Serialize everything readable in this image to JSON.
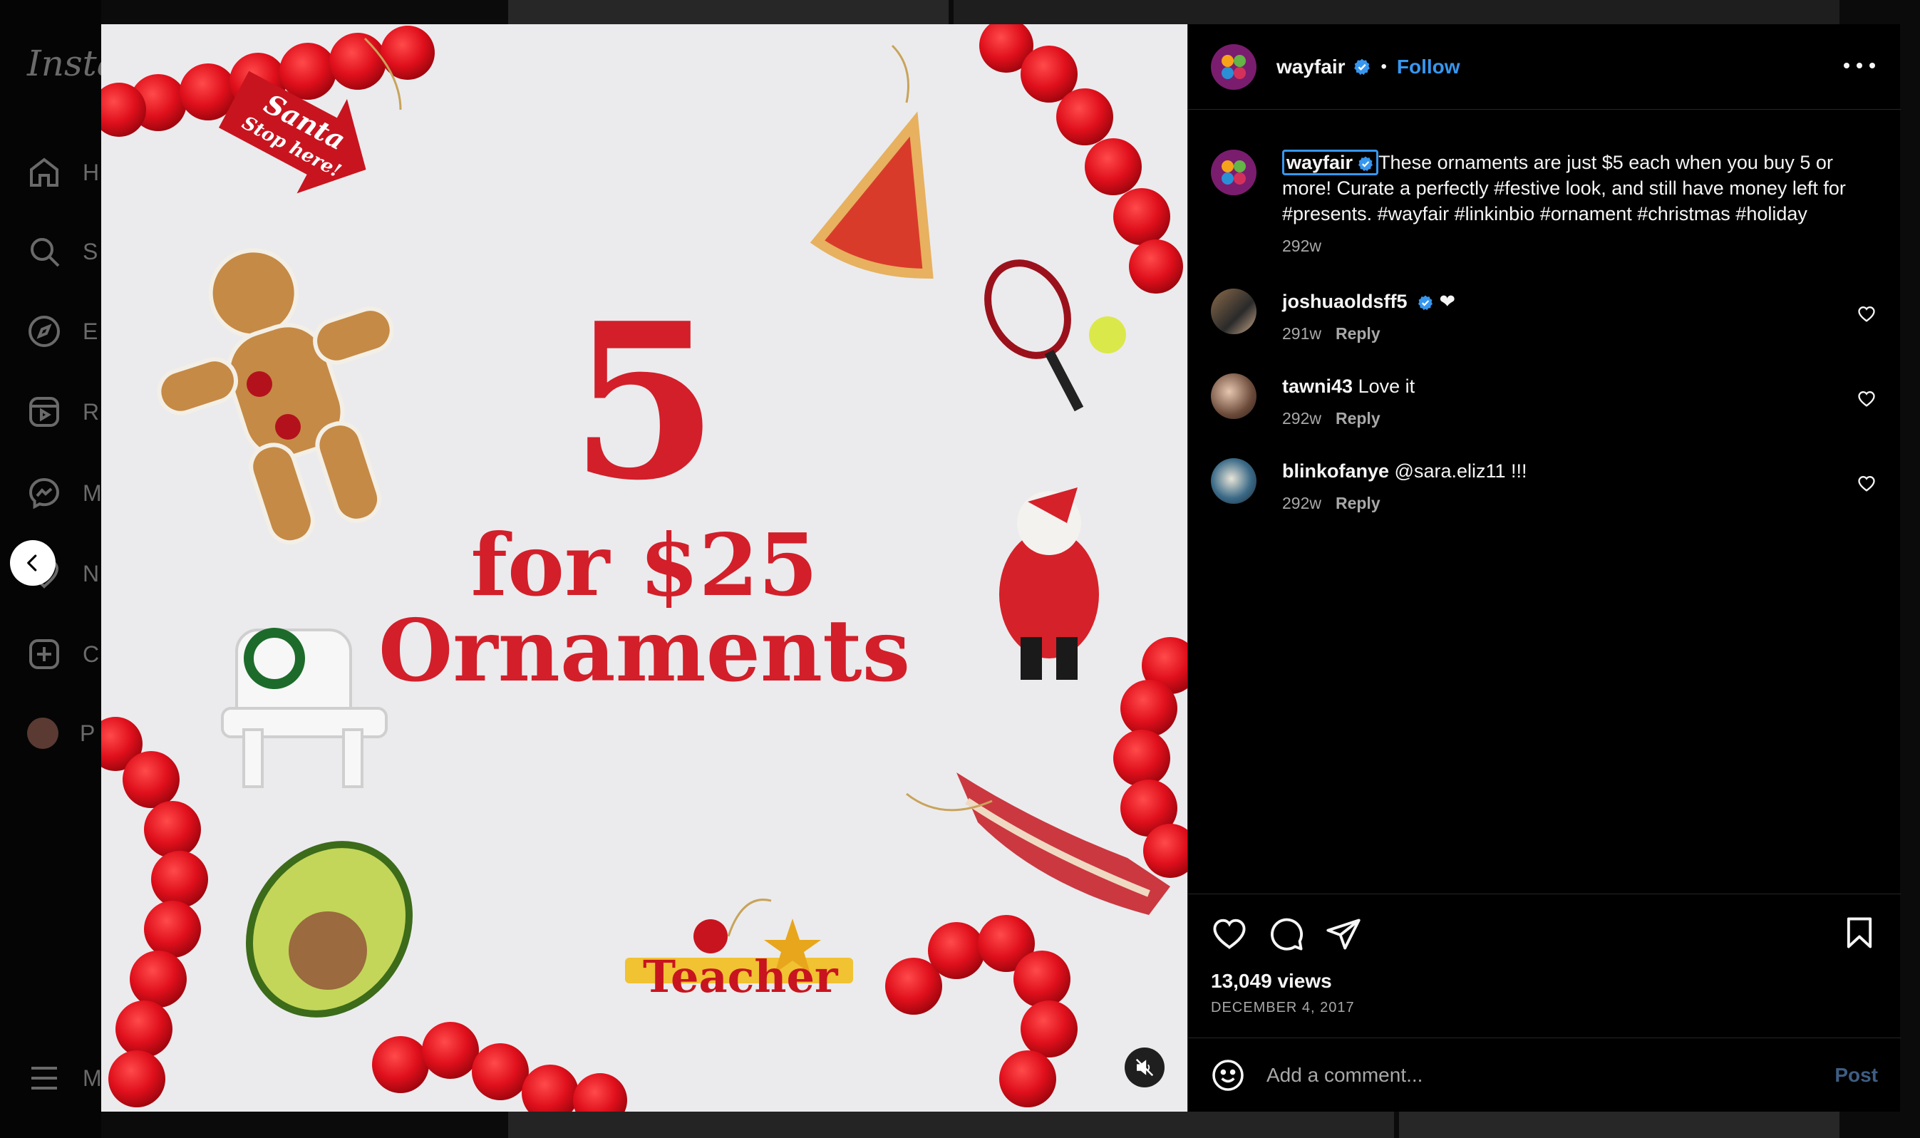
{
  "sidebar": {
    "logo": "Insta",
    "items": [
      {
        "label": "H",
        "icon": "home-icon"
      },
      {
        "label": "S",
        "icon": "search-icon"
      },
      {
        "label": "E",
        "icon": "explore-icon"
      },
      {
        "label": "R",
        "icon": "reels-icon"
      },
      {
        "label": "M",
        "icon": "messenger-icon"
      },
      {
        "label": "N",
        "icon": "notifications-icon"
      },
      {
        "label": "C",
        "icon": "create-icon"
      },
      {
        "label": "P",
        "icon": "profile-avatar"
      }
    ],
    "more_label": "M"
  },
  "media": {
    "promo_big": "5",
    "promo_line2": "for $25",
    "promo_line3": "Ornaments",
    "ornament_sign_line1": "Santa",
    "ornament_sign_line2": "Stop here!",
    "ornament_teacher": "Teacher",
    "mute_icon": "muted-speaker-icon"
  },
  "post": {
    "author": "wayfair",
    "verified": true,
    "follow_label": "Follow",
    "caption_user": "wayfair",
    "caption_text": "These ornaments are just $5 each when you buy 5 or more! Curate a perfectly #festive look, and still have money left for #presents. #wayfair #linkinbio #ornament #christmas #holiday",
    "caption_age": "292w",
    "comments": [
      {
        "user": "joshuaoldsff5",
        "verified": true,
        "text": "❤",
        "age": "291w",
        "reply": "Reply"
      },
      {
        "user": "tawni43",
        "verified": false,
        "text": "Love it",
        "age": "292w",
        "reply": "Reply"
      },
      {
        "user": "blinkofanye",
        "verified": false,
        "text": "@sara.eliz11 !!!",
        "age": "292w",
        "reply": "Reply"
      }
    ],
    "views": "13,049 views",
    "date": "DECEMBER 4, 2017",
    "comment_placeholder": "Add a comment...",
    "post_label": "Post"
  },
  "colors": {
    "accent_blue": "#3797f0",
    "promo_red": "#d21f2a",
    "panel_bg": "#000000"
  }
}
